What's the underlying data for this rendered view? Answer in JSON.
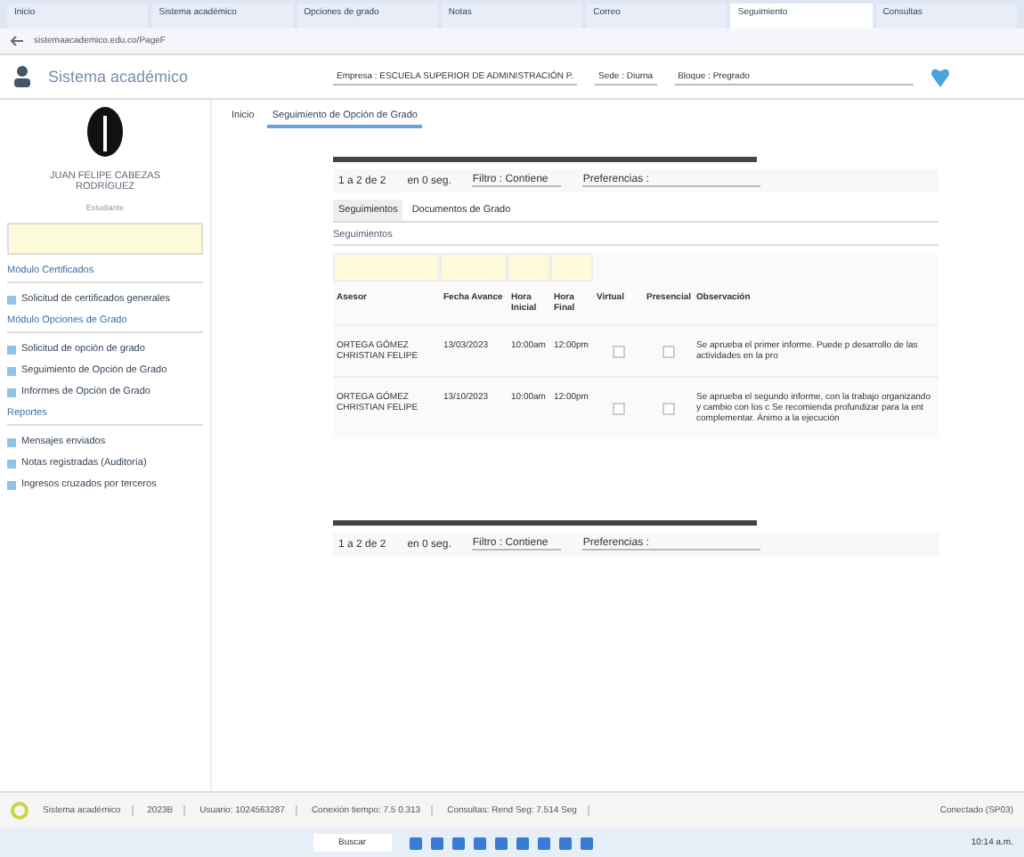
{
  "browser": {
    "tabs": [
      {
        "label": "Inicio",
        "selected": false
      },
      {
        "label": "Sistema académico",
        "selected": false
      },
      {
        "label": "Opciones de grado",
        "selected": false
      },
      {
        "label": "Notas",
        "selected": false
      },
      {
        "label": "Correo",
        "selected": false
      },
      {
        "label": "Seguimiento",
        "selected": true
      },
      {
        "label": "Consultas",
        "selected": false
      }
    ],
    "address": "sistemaacademico.edu.co/PageF"
  },
  "header": {
    "app_title": "Sistema académico",
    "empresa": "Empresa : ESCUELA SUPERIOR DE ADMINISTRACIÓN P.",
    "sede": "Sede : Diurna",
    "bloque": "Bloque : Pregrado"
  },
  "breadcrumb": [
    {
      "label": "Inicio",
      "selected": false
    },
    {
      "label": "Seguimiento de Opción de Grado",
      "selected": true
    }
  ],
  "user": {
    "name": "JUAN FELIPE CABEZAS RODRÍGUEZ",
    "role": "Estudiante"
  },
  "sidebar": [
    {
      "kind": "heading",
      "label": "Módulo Certificados"
    },
    {
      "kind": "item",
      "label": "Solicitud de certificados generales"
    },
    {
      "kind": "heading",
      "label": "Módulo Opciones de Grado"
    },
    {
      "kind": "item",
      "label": "Solicitud de opción de grado"
    },
    {
      "kind": "item",
      "label": "Seguimiento de Opción de Grado"
    },
    {
      "kind": "item",
      "label": "Informes de Opción de Grado"
    },
    {
      "kind": "heading",
      "label": "Reportes"
    },
    {
      "kind": "item",
      "label": "Mensajes enviados"
    },
    {
      "kind": "item",
      "label": "Notas registradas (Auditoría)"
    },
    {
      "kind": "item",
      "label": "Ingresos cruzados por terceros"
    }
  ],
  "pager_top": {
    "range": "1 a 2 de 2",
    "time": "en 0 seg.",
    "filter": "Filtro : Contiene",
    "prefs": "Preferencias :"
  },
  "tabs": [
    {
      "label": "Seguimientos",
      "selected": true
    },
    {
      "label": "Documentos de Grado",
      "selected": false
    }
  ],
  "section": "Seguimientos",
  "table": {
    "columns": [
      "Asesor",
      "Fecha Avance",
      "Hora Inicial",
      "Hora Final",
      "Virtual",
      "Presencial",
      "Observación"
    ],
    "rows": [
      {
        "asesor": "ORTEGA GÓMEZ CHRISTIAN FELIPE",
        "fecha": "13/03/2023",
        "inicio": "10:00am",
        "fin": "12:00pm",
        "virtual": false,
        "presencial": false,
        "obs": "Se aprueba el primer informe. Puede p desarrollo de las actividades en la pro"
      },
      {
        "asesor": "ORTEGA GÓMEZ CHRISTIAN FELIPE",
        "fecha": "13/10/2023",
        "inicio": "10:00am",
        "fin": "12:00pm",
        "virtual": false,
        "presencial": false,
        "obs": "Se aprueba el segundo informe, con la trabajo organizando y cambio con los c Se recomienda profundizar para la ent complementar. Ánimo a la ejecución"
      }
    ]
  },
  "pager_bottom": {
    "range": "1 a 2 de 2",
    "time": "en 0 seg.",
    "filter": "Filtro : Contiene",
    "prefs": "Preferencias :"
  },
  "status_bar": [
    "Sistema académico",
    "2023B",
    "Usuario: 1024563287",
    "Conexión tiempo: 7.5 0.313",
    "Consultas: Rend Seg: 7.514 Seg"
  ],
  "status_right": "Conectado (SP03)",
  "taskbar": {
    "search": "Buscar",
    "time": "10:14 a.m."
  }
}
